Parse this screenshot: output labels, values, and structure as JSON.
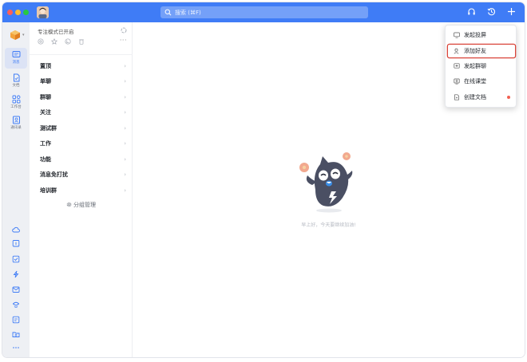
{
  "titlebar": {
    "search_placeholder": "搜索 (⌘F)",
    "icons": [
      "headset-icon",
      "history-icon",
      "plus-icon"
    ]
  },
  "rail": {
    "items": [
      {
        "label": "消息",
        "icon": "message-icon",
        "active": true
      },
      {
        "label": "文档",
        "icon": "document-icon",
        "active": false
      },
      {
        "label": "工作台",
        "icon": "workbench-icon",
        "active": false
      },
      {
        "label": "通讯录",
        "icon": "contacts-icon",
        "active": false
      }
    ],
    "apps": [
      "cloud-icon",
      "calendar-icon",
      "todo-icon",
      "lightning-icon",
      "mail-icon",
      "minutes-icon",
      "approval-icon",
      "folder-icon",
      "more-icon"
    ]
  },
  "list": {
    "focus_mode": "专注模式已开启",
    "groups": [
      "置顶",
      "单聊",
      "群聊",
      "关注",
      "测试群",
      "工作",
      "功能",
      "消息免打扰",
      "培训群"
    ],
    "group_manage": "分组管理",
    "more": "···"
  },
  "main": {
    "empty_text": "早上好，今天要继续加油!"
  },
  "menu": {
    "items": [
      {
        "label": "发起投屏",
        "icon": "screen-share-icon"
      },
      {
        "label": "添加好友",
        "icon": "add-friend-icon",
        "highlighted": true
      },
      {
        "label": "发起群聊",
        "icon": "group-chat-icon"
      },
      {
        "label": "在线课堂",
        "icon": "classroom-icon"
      },
      {
        "label": "创建文档",
        "icon": "create-doc-icon",
        "badge": true
      }
    ]
  },
  "colors": {
    "titlebar": "#3f7cf6",
    "highlight_border": "#d9453a",
    "badge": "#f25f50"
  }
}
